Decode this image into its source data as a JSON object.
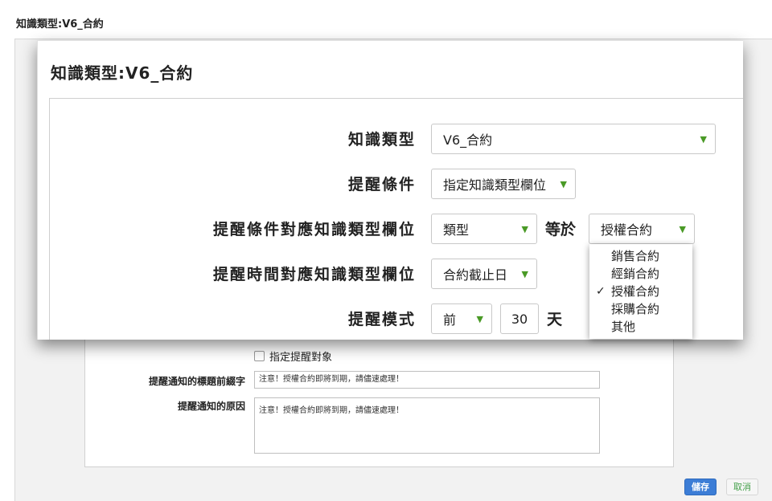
{
  "page": {
    "title": "知識類型:V6_合約"
  },
  "background_form": {
    "specify_target_label": "指定提醒對象",
    "subject_prefix_label": "提醒通知的標題前綴字",
    "subject_prefix_value": "注意！授權合約即將到期，請儘速處理！",
    "reason_label": "提醒通知的原因",
    "reason_value": "注意！授權合約即將到期，請儘速處理！",
    "save_label": "儲存",
    "cancel_label": "取消"
  },
  "zoom": {
    "title": "知識類型:V6_合約",
    "rows": {
      "knowledge_type": {
        "label": "知識類型",
        "value": "V6_合約"
      },
      "condition": {
        "label": "提醒條件",
        "value": "指定知識類型欄位"
      },
      "condition_field": {
        "label": "提醒條件對應知識類型欄位",
        "value": "類型",
        "equals": "等於",
        "equals_value": "授權合約"
      },
      "time_field": {
        "label": "提醒時間對應知識類型欄位",
        "value": "合約截止日"
      },
      "mode": {
        "label": "提醒模式",
        "value": "前",
        "number": "30",
        "unit": "天"
      }
    },
    "dropdown": {
      "options": [
        "銷售合約",
        "經銷合約",
        "授權合約",
        "採購合約",
        "其他"
      ],
      "selected": "授權合約",
      "check": "✓"
    }
  },
  "colors": {
    "accent": "#3c7dd6",
    "caret": "#4a9a26",
    "cancel_text": "#44a04a"
  }
}
